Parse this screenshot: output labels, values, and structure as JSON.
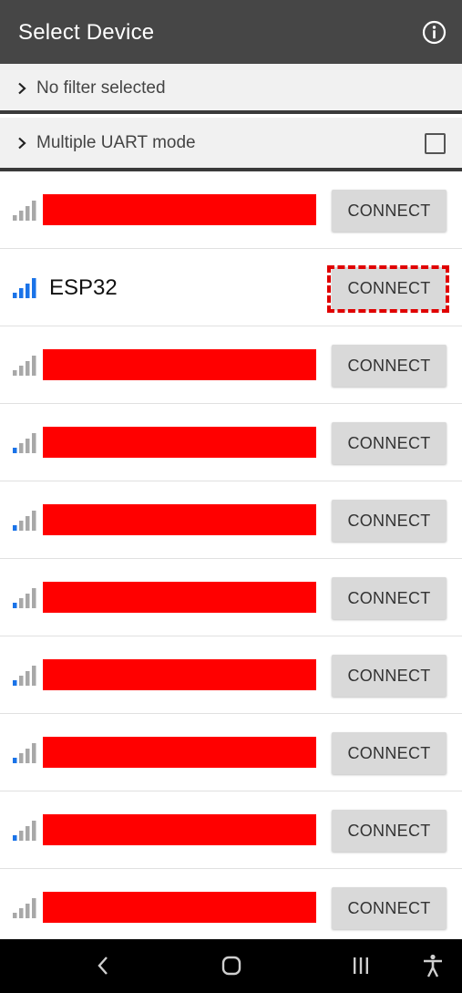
{
  "app_bar": {
    "title": "Select Device",
    "info_icon": "info-circle-icon"
  },
  "filter": {
    "label": "No filter selected",
    "icon": "chevron-right-icon"
  },
  "uart": {
    "label": "Multiple UART mode",
    "checked": false,
    "icon": "chevron-right-icon"
  },
  "devices": [
    {
      "name": "",
      "redacted": true,
      "signal_bars": 0,
      "connect_label": "CONNECT"
    },
    {
      "name": "ESP32",
      "redacted": false,
      "signal_bars": 4,
      "connect_label": "CONNECT",
      "highlighted": true
    },
    {
      "name": "",
      "redacted": true,
      "signal_bars": 0,
      "connect_label": "CONNECT"
    },
    {
      "name": "",
      "redacted": true,
      "signal_bars": 1,
      "connect_label": "CONNECT"
    },
    {
      "name": "",
      "redacted": true,
      "signal_bars": 1,
      "connect_label": "CONNECT"
    },
    {
      "name": "",
      "redacted": true,
      "signal_bars": 1,
      "connect_label": "CONNECT"
    },
    {
      "name": "",
      "redacted": true,
      "signal_bars": 1,
      "connect_label": "CONNECT"
    },
    {
      "name": "",
      "redacted": true,
      "signal_bars": 1,
      "connect_label": "CONNECT"
    },
    {
      "name": "",
      "redacted": true,
      "signal_bars": 1,
      "connect_label": "CONNECT"
    },
    {
      "name": "",
      "redacted": true,
      "signal_bars": 0,
      "connect_label": "CONNECT"
    }
  ],
  "nav_bar": {
    "back_icon": "back-chevron-icon",
    "home_icon": "home-icon",
    "recents_icon": "recents-icon",
    "accessibility_icon": "accessibility-icon"
  },
  "colors": {
    "app_bar_bg": "#464646",
    "signal_active": "#1a73e8",
    "signal_inactive": "#a8a8a8",
    "redaction": "#ff0000",
    "highlight": "#e00000",
    "connect_bg": "#d9d9d9"
  }
}
